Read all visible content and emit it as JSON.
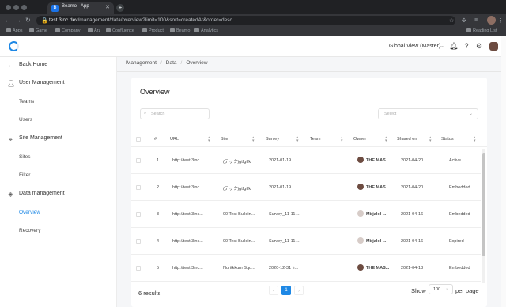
{
  "browser": {
    "tab_title": "Beamo - App",
    "tab_close": "✕",
    "new_tab": "+",
    "url_host": "test.3inc.dev",
    "url_path": "/management/data/overview?limit=100&sort=createdAt&order=desc",
    "bookmarks": [
      "Apps",
      "Game",
      "Company",
      "Arz",
      "Confluence",
      "Product",
      "Beamo",
      "Analytics"
    ],
    "reading_list": "Reading List"
  },
  "header": {
    "global_view": "Global View (Master)"
  },
  "sidebar": {
    "back": "Back Home",
    "user_management": "User Management",
    "teams": "Teams",
    "users": "Users",
    "site_management": "Site Management",
    "sites": "Sites",
    "filter": "Filter",
    "data_management": "Data management",
    "overview": "Overview",
    "recovery": "Recovery"
  },
  "breadcrumb": [
    "Management",
    "Data",
    "Overview"
  ],
  "page": {
    "title": "Overview",
    "search_placeholder": "Search",
    "select_placeholder": "Select"
  },
  "table": {
    "columns": [
      "#",
      "URL",
      "Site",
      "Survey",
      "Team",
      "Owner",
      "Shared on",
      "Status"
    ],
    "rows": [
      {
        "num": "1",
        "url": "http://test.3inc...",
        "site": "(テック)gtfgtfk",
        "survey": "2021-01-19",
        "team": "",
        "owner": "THE MAS...",
        "shared": "2021-04-20",
        "status": "Active",
        "owner_light": false
      },
      {
        "num": "2",
        "url": "http://test.3inc...",
        "site": "(テック)gtfgtfk",
        "survey": "2021-01-19",
        "team": "",
        "owner": "THE MAS...",
        "shared": "2021-04-20",
        "status": "Embedded",
        "owner_light": false
      },
      {
        "num": "3",
        "url": "http://test.3inc...",
        "site": "00 Test Buildin...",
        "survey": "Survey_11-11-...",
        "team": "",
        "owner": "Mirjalol ...",
        "shared": "2021-04-16",
        "status": "Embedded",
        "owner_light": true
      },
      {
        "num": "4",
        "url": "http://test.3inc...",
        "site": "00 Test Buildin...",
        "survey": "Survey_11-11-...",
        "team": "",
        "owner": "Mirjalol ...",
        "shared": "2021-04-16",
        "status": "Expired",
        "owner_light": true
      },
      {
        "num": "5",
        "url": "http://test.3inc...",
        "site": "Nuritkkum Squ...",
        "survey": "2020-12-31 fr...",
        "team": "",
        "owner": "THE MAS...",
        "shared": "2021-04-13",
        "status": "Embedded",
        "owner_light": false
      }
    ]
  },
  "footer": {
    "results": "6 results",
    "current_page": "1",
    "show_label": "Show",
    "page_size": "100",
    "per_page_label": "per page"
  },
  "colors": {
    "accent": "#1e88e5",
    "active_nav": "#1e88e5"
  }
}
